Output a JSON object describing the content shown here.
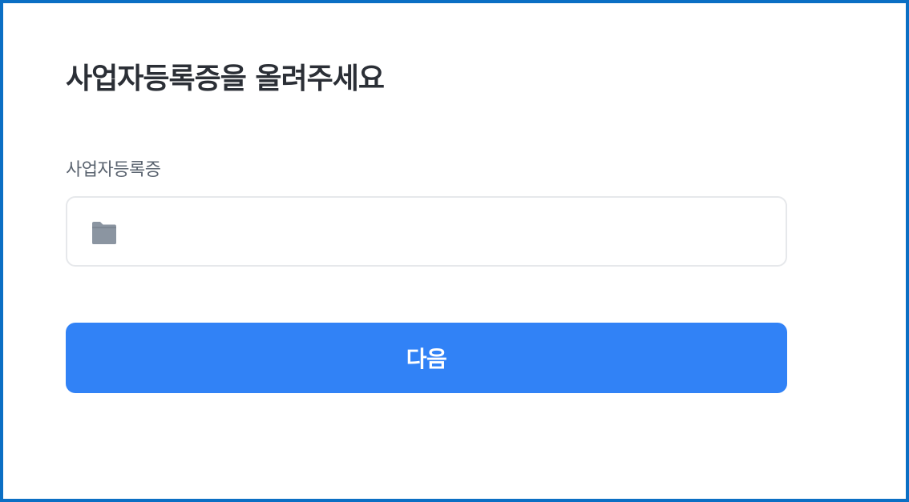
{
  "page": {
    "title": "사업자등록증을 올려주세요"
  },
  "upload_field": {
    "label": "사업자등록증",
    "icon": "folder-icon",
    "icon_color": "#8b95a1",
    "border_color": "#e6e8eb"
  },
  "actions": {
    "next_label": "다음",
    "next_color": "#3182f6"
  },
  "colors": {
    "frame_border": "#0b6fc4",
    "title_text": "#2b2f36",
    "label_text": "#5b6470"
  }
}
